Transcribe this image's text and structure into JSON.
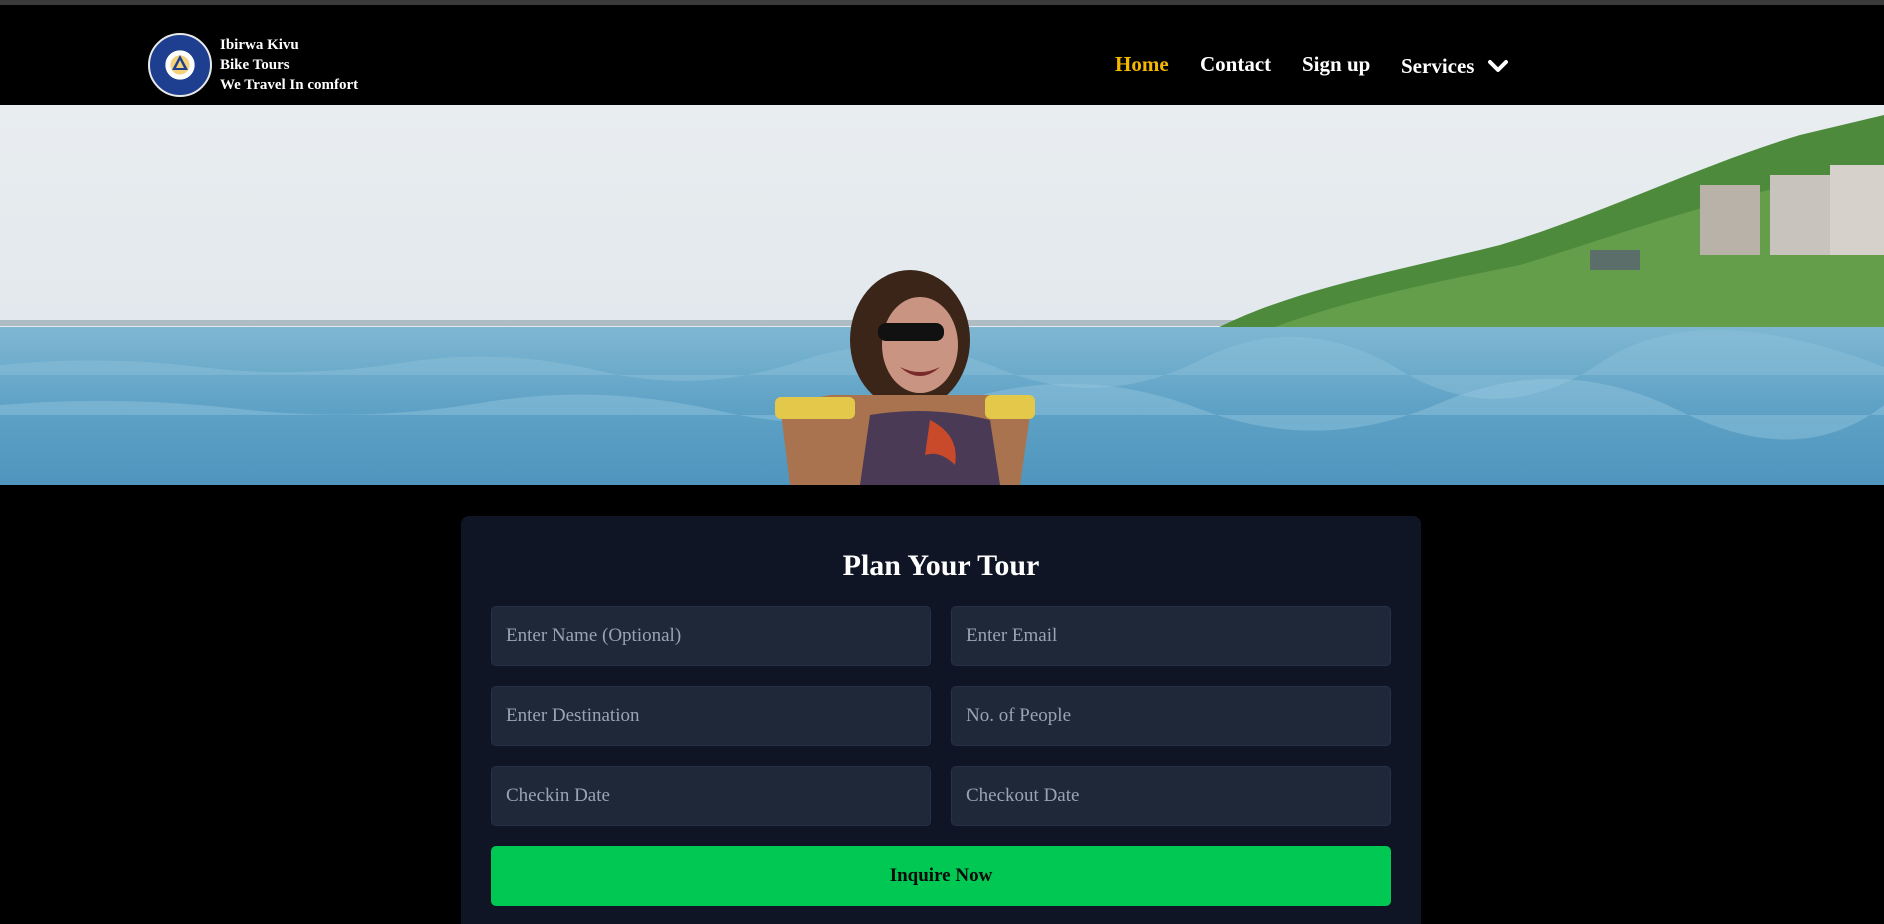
{
  "brand": {
    "line1": "Ibirwa Kivu",
    "line2": "Bike Tours",
    "line3": "We Travel In comfort",
    "logo_icon": "logo-badge-icon"
  },
  "nav": {
    "home": "Home",
    "contact": "Contact",
    "signup": "Sign up",
    "services": "Services",
    "services_icon": "chevron-down-icon",
    "active_color": "#f5b800"
  },
  "hero": {
    "image": "woman-on-water-photo"
  },
  "form": {
    "title": "Plan Your Tour",
    "name_placeholder": "Enter Name (Optional)",
    "email_placeholder": "Enter Email",
    "destination_placeholder": "Enter Destination",
    "people_placeholder": "No. of People",
    "checkin_placeholder": "Checkin Date",
    "checkout_placeholder": "Checkout Date",
    "submit_label": "Inquire Now",
    "submit_color": "#00c853"
  }
}
